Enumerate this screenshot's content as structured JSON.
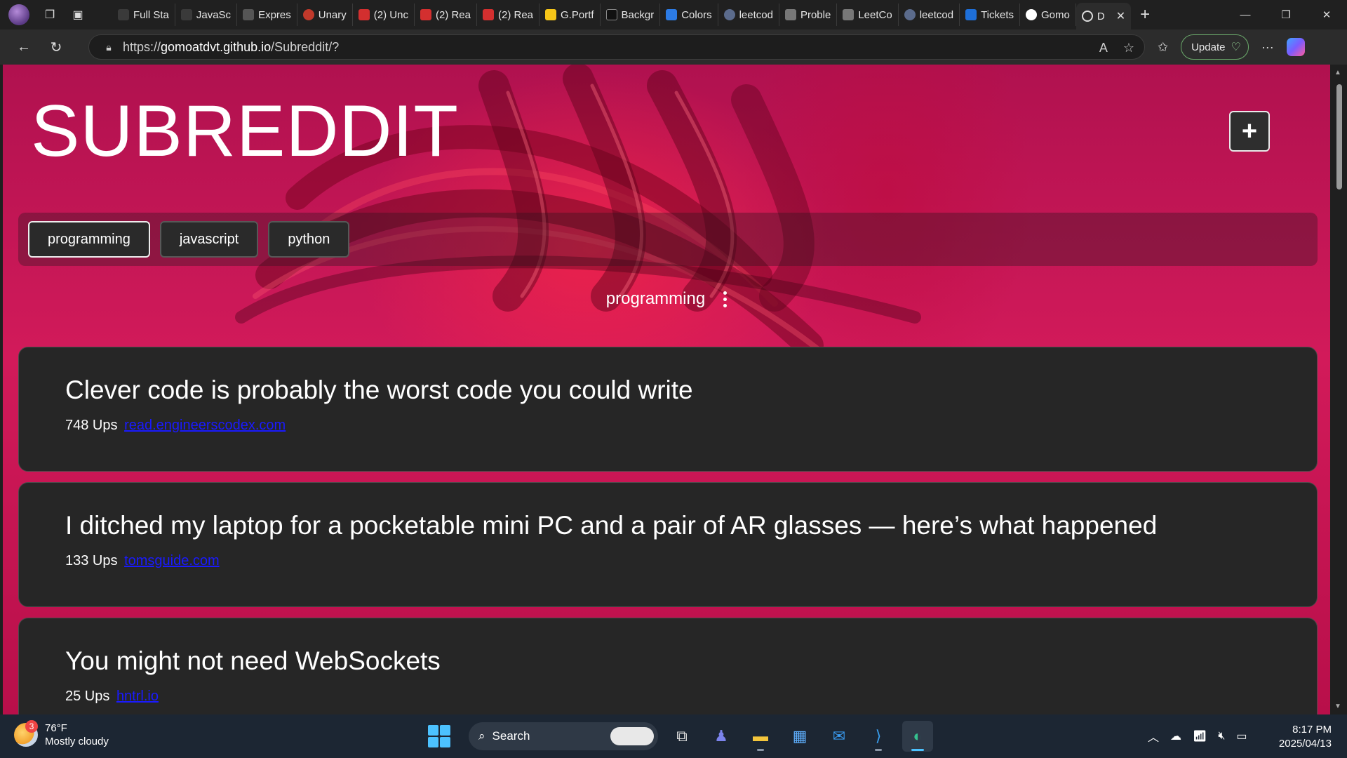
{
  "browser": {
    "tabs": [
      {
        "label": "Full Sta",
        "color": "#cfcfcf"
      },
      {
        "label": "JavaSc",
        "color": "#cfcfcf"
      },
      {
        "label": "Expres",
        "color": "#8a8a8a"
      },
      {
        "label": "Unary",
        "color": "#c0392b"
      },
      {
        "label": "(2) Unc",
        "color": "#d32f2f"
      },
      {
        "label": "(2) Rea",
        "color": "#d32f2f"
      },
      {
        "label": "(2) Rea",
        "color": "#d32f2f"
      },
      {
        "label": "G.Portf",
        "color": "#f5c518"
      },
      {
        "label": "Backgr",
        "color": "#111111"
      },
      {
        "label": "Colors",
        "color": "#2c7be5"
      },
      {
        "label": "leetcod",
        "color": "#5b6b8c"
      },
      {
        "label": "Proble",
        "color": "#777777"
      },
      {
        "label": "LeetCo",
        "color": "#777777"
      },
      {
        "label": "leetcod",
        "color": "#5b6b8c"
      },
      {
        "label": "Tickets",
        "color": "#1e6fd9"
      },
      {
        "label": "Gomo",
        "color": "#ffffff"
      }
    ],
    "active_tab": {
      "label": "D"
    },
    "url_prefix": "https://",
    "url_host": "gomoatdvt.github.io",
    "url_path": "/Subreddit/?",
    "update_label": "Update"
  },
  "page": {
    "title": "SUBREDDIT",
    "add_label": "+",
    "filters": [
      {
        "label": "programming",
        "active": true
      },
      {
        "label": "javascript",
        "active": false
      },
      {
        "label": "python",
        "active": false
      }
    ],
    "section": "programming",
    "posts": [
      {
        "title": "Clever code is probably the worst code you could write",
        "ups": "748 Ups",
        "link": "read.engineerscodex.com"
      },
      {
        "title": "I ditched my laptop for a pocketable mini PC and a pair of AR glasses — here’s what happened",
        "ups": "133 Ups",
        "link": "tomsguide.com"
      },
      {
        "title": "You might not need WebSockets",
        "ups": "25 Ups",
        "link": "hntrl.io"
      }
    ]
  },
  "taskbar": {
    "weather_badge": "3",
    "temperature": "76°F",
    "condition": "Mostly cloudy",
    "search_label": "Search",
    "time": "8:17 PM",
    "date": "2025/04/13"
  },
  "colors": {
    "accent": "#d21a5a",
    "card": "#262626",
    "link": "#1a1aff"
  }
}
